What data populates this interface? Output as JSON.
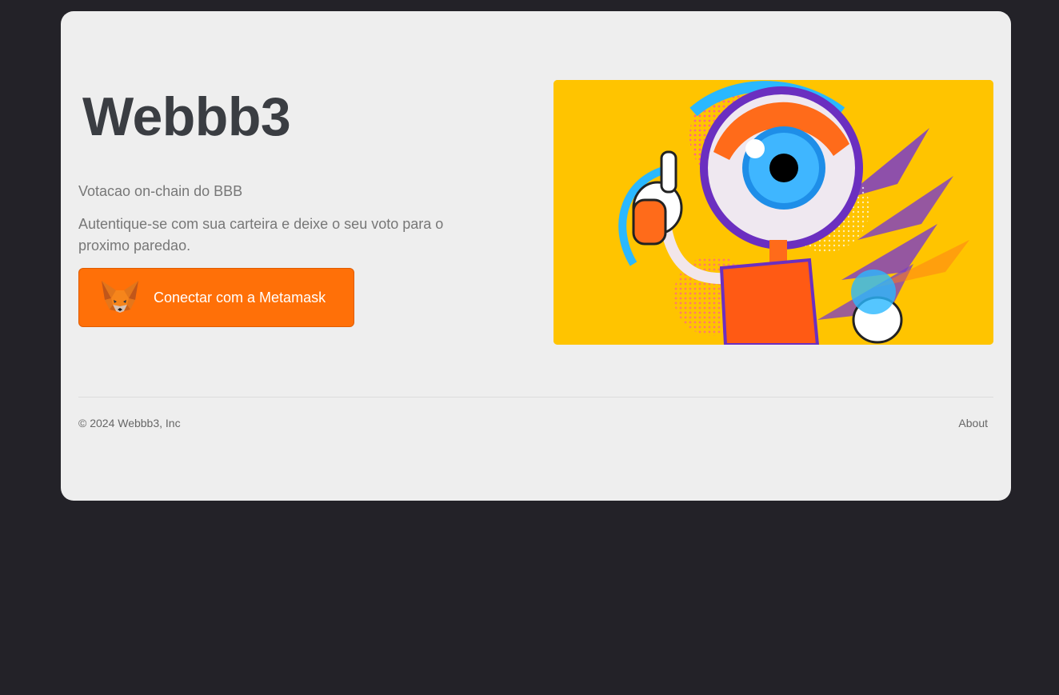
{
  "hero": {
    "title": "Webbb3",
    "subtitle": "Votacao on-chain do BBB",
    "description": "Autentique-se com sua carteira e deixe o seu voto para o proximo paredao.",
    "connect_button": {
      "label": "Conectar com a Metamask",
      "icon": "metamask-fox-icon"
    },
    "illustration": {
      "icon": "big-brother-eye-mascot-illustration"
    }
  },
  "footer": {
    "copyright": "© 2024 Webbb3, Inc",
    "about_link": "About"
  },
  "colors": {
    "page_background": "#232228",
    "card_background": "#eeeeee",
    "title": "#3a3d42",
    "text_muted": "#777777",
    "button_background": "#ff7008",
    "button_text": "#ffffff",
    "illustration_background": "#ffc400"
  }
}
